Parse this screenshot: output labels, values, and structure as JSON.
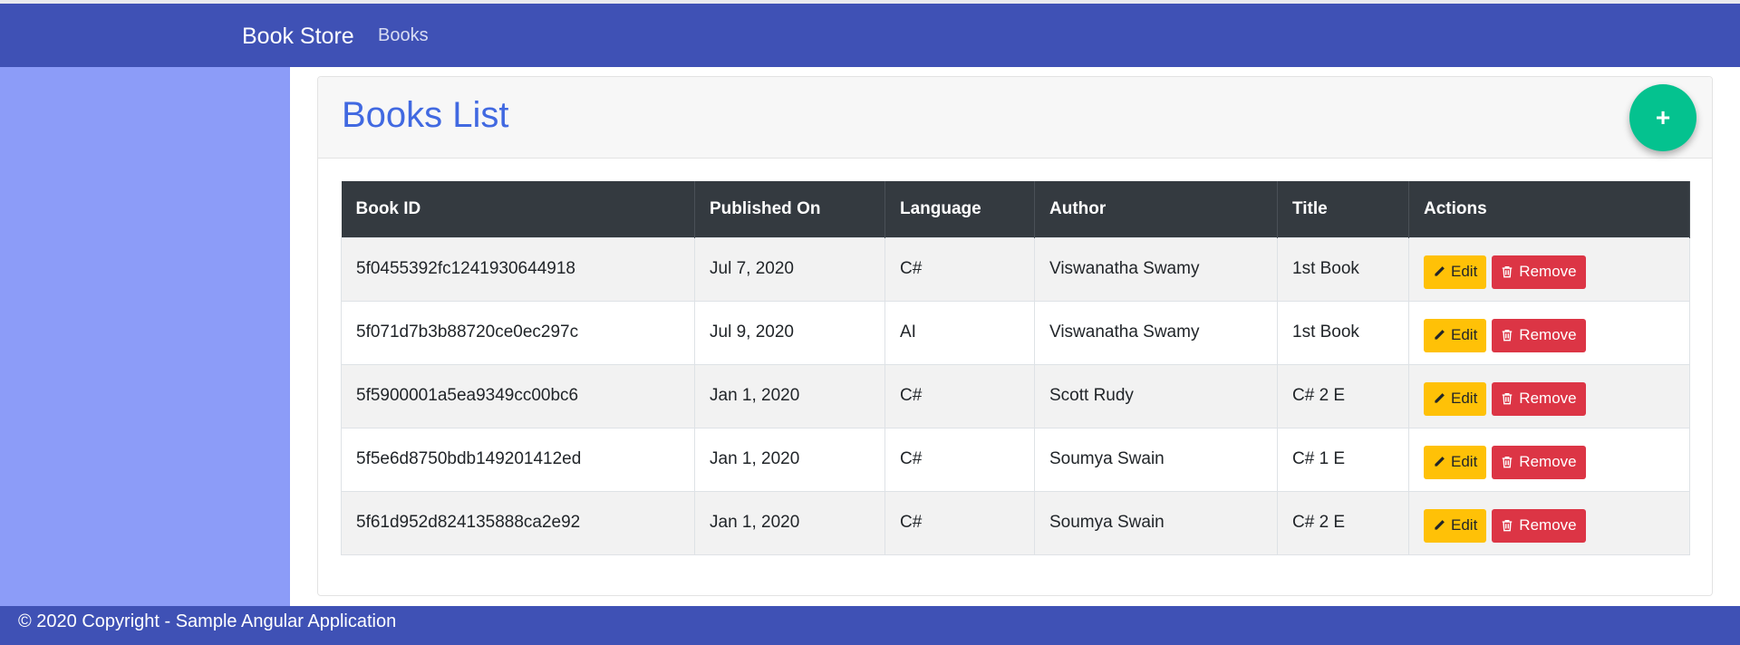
{
  "navbar": {
    "brand": "Book Store",
    "links": [
      {
        "label": "Books"
      }
    ]
  },
  "card": {
    "title": "Books List",
    "add_button_label": "+"
  },
  "table": {
    "headers": [
      "Book ID",
      "Published On",
      "Language",
      "Author",
      "Title",
      "Actions"
    ],
    "rows": [
      [
        "5f0455392fc1241930644918",
        "Jul 7, 2020",
        "C#",
        "Viswanatha Swamy",
        "1st Book"
      ],
      [
        "5f071d7b3b88720ce0ec297c",
        "Jul 9, 2020",
        "AI",
        "Viswanatha Swamy",
        "1st Book"
      ],
      [
        "5f5900001a5ea9349cc00bc6",
        "Jan 1, 2020",
        "C#",
        "Scott Rudy",
        "C# 2 E"
      ],
      [
        "5f5e6d8750bdb149201412ed",
        "Jan 1, 2020",
        "C#",
        "Soumya Swain",
        "C# 1 E"
      ],
      [
        "5f61d952d824135888ca2e92",
        "Jan 1, 2020",
        "C#",
        "Soumya Swain",
        "C# 2 E"
      ]
    ],
    "actions": {
      "edit_label": "Edit",
      "remove_label": "Remove",
      "edit_icon": "pencil-icon",
      "remove_icon": "trash-icon"
    }
  },
  "footer": {
    "text": "© 2020 Copyright - Sample Angular Application"
  },
  "colors": {
    "navbar": "#3f51b5",
    "sidebar": "#8c9cf8",
    "title": "#4169e1",
    "fab": "#04c28f",
    "table_header": "#343a40",
    "edit": "#ffc107",
    "remove": "#dc3545"
  }
}
